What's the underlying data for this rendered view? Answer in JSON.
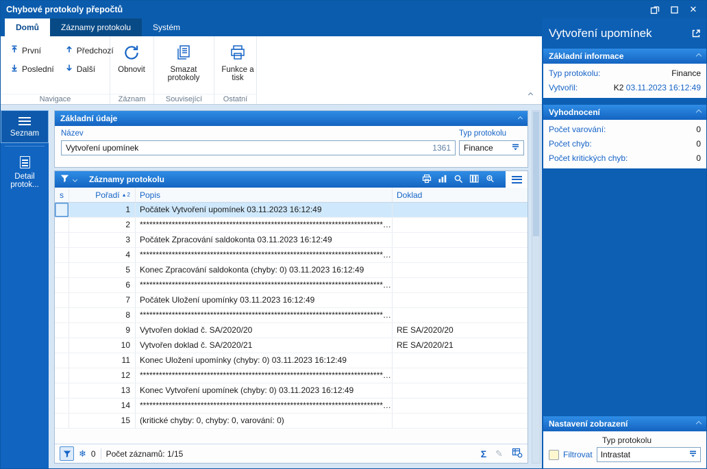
{
  "window": {
    "title": "Chybové protokoly přepočtů"
  },
  "icons": {
    "close": "✕",
    "snowflake": "❄",
    "sum": "Σ",
    "pencil": "✎"
  },
  "tabs": {
    "home": "Domů",
    "records": "Záznamy protokolu",
    "system": "Systém"
  },
  "ribbon": {
    "nav_first": "První",
    "nav_prev": "Předchozí",
    "nav_last": "Poslední",
    "nav_next": "Další",
    "group_nav": "Navigace",
    "refresh": "Obnovit",
    "group_record": "Záznam",
    "delete_protocols": "Smazat protokoly",
    "group_related": "Související",
    "functions_print": "Funkce a tisk",
    "group_other": "Ostatní"
  },
  "sidebar": {
    "items": [
      {
        "label": "Seznam"
      },
      {
        "label": "Detail protok..."
      }
    ]
  },
  "basic_panel": {
    "title": "Základní údaje",
    "name_label": "Název",
    "name_value": "Vytvoření upomínek",
    "name_id": "1361",
    "type_label": "Typ protokolu",
    "type_value": "Finance"
  },
  "records_panel": {
    "title": "Záznamy protokolu",
    "columns": {
      "s": "s",
      "order": "Pořadí",
      "description": "Popis",
      "document": "Doklad"
    },
    "sort": {
      "arrow": "▲",
      "priority": "2"
    },
    "rows": [
      {
        "order": "1",
        "desc": "Počátek Vytvoření upomínek 03.11.2023 16:12:49",
        "doc": "",
        "selected": true
      },
      {
        "order": "2",
        "desc": "****************************************************************************************************",
        "doc": ""
      },
      {
        "order": "3",
        "desc": "Počátek Zpracování saldokonta 03.11.2023 16:12:49",
        "doc": ""
      },
      {
        "order": "4",
        "desc": "****************************************************************************************************",
        "doc": ""
      },
      {
        "order": "5",
        "desc": "Konec Zpracování saldokonta (chyby: 0) 03.11.2023 16:12:49",
        "doc": ""
      },
      {
        "order": "6",
        "desc": "****************************************************************************************************",
        "doc": ""
      },
      {
        "order": "7",
        "desc": "Počátek Uložení upomínky 03.11.2023 16:12:49",
        "doc": ""
      },
      {
        "order": "8",
        "desc": "****************************************************************************************************",
        "doc": ""
      },
      {
        "order": "9",
        "desc": "Vytvořen doklad č. SA/2020/20",
        "doc": "RE SA/2020/20"
      },
      {
        "order": "10",
        "desc": "Vytvořen doklad č. SA/2020/21",
        "doc": "RE SA/2020/21"
      },
      {
        "order": "11",
        "desc": "Konec Uložení upomínky (chyby: 0) 03.11.2023 16:12:49",
        "doc": ""
      },
      {
        "order": "12",
        "desc": "****************************************************************************************************",
        "doc": ""
      },
      {
        "order": "13",
        "desc": "Konec Vytvoření upomínek (chyby: 0) 03.11.2023 16:12:49",
        "doc": ""
      },
      {
        "order": "14",
        "desc": "****************************************************************************************************",
        "doc": ""
      },
      {
        "order": "15",
        "desc": "(kritické chyby: 0, chyby: 0, varování: 0)",
        "doc": ""
      }
    ],
    "status": {
      "frozen_count": "0",
      "record_count": "Počet záznamů: 1/15"
    }
  },
  "right_panel": {
    "title": "Vytvoření upomínek",
    "basic_info": {
      "title": "Základní informace",
      "type_label": "Typ protokolu:",
      "type_value": "Finance",
      "created_label": "Vytvořil:",
      "created_user": "K2",
      "created_date": "03.11.2023 16:12:49"
    },
    "evaluation": {
      "title": "Vyhodnocení",
      "rows": [
        {
          "label": "Počet varování:",
          "value": "0"
        },
        {
          "label": "Počet chyb:",
          "value": "0"
        },
        {
          "label": "Počet kritických chyb:",
          "value": "0"
        }
      ]
    },
    "display_settings": {
      "title": "Nastavení zobrazení",
      "type_label": "Typ protokolu",
      "filter_label": "Filtrovat",
      "type_value": "Intrastat"
    }
  }
}
